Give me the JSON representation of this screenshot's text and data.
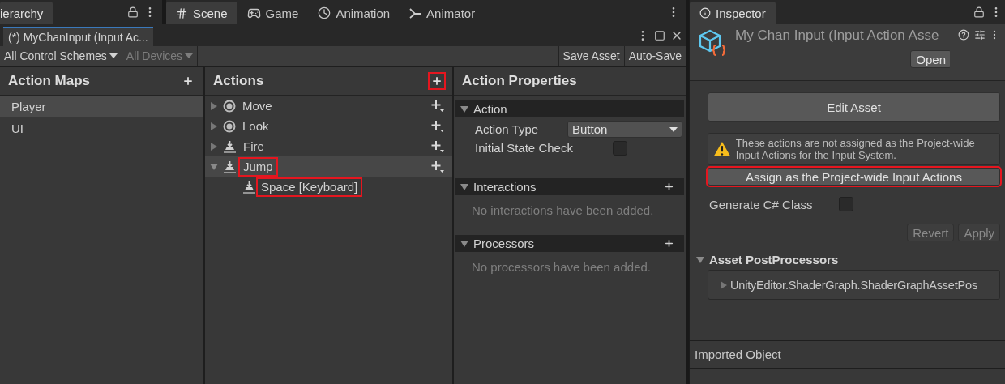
{
  "top_tabs": {
    "hierarchy": {
      "label": "ierarchy",
      "selected": true
    },
    "center": [
      {
        "label": "Scene",
        "kind": "scene",
        "selected": true
      },
      {
        "label": "Game",
        "kind": "game",
        "selected": false
      },
      {
        "label": "Animation",
        "kind": "animation",
        "selected": false
      },
      {
        "label": "Animator",
        "kind": "animator",
        "selected": false
      }
    ]
  },
  "editor": {
    "tab_title": "(*) MyChanInput (Input Ac...",
    "toolbar": {
      "control_scheme": "All Control Schemes",
      "devices": {
        "label": "All Devices",
        "disabled": true
      },
      "buttons": [
        "Save Asset",
        "Auto-Save"
      ]
    },
    "action_maps": {
      "title": "Action Maps",
      "items": [
        {
          "label": "Player",
          "selected": true
        },
        {
          "label": "UI",
          "selected": false
        }
      ]
    },
    "actions": {
      "title": "Actions",
      "add_highlighted": true,
      "items": [
        {
          "label": "Move",
          "kind": "value",
          "expanded": false,
          "selected": false,
          "highlighted": false
        },
        {
          "label": "Look",
          "kind": "value",
          "expanded": false,
          "selected": false,
          "highlighted": false
        },
        {
          "label": "Fire",
          "kind": "button",
          "expanded": false,
          "selected": false,
          "highlighted": false
        },
        {
          "label": "Jump",
          "kind": "button",
          "expanded": true,
          "selected": true,
          "highlighted": true,
          "children": [
            {
              "label": "Space [Keyboard]",
              "highlighted": true
            }
          ]
        }
      ]
    },
    "properties": {
      "title": "Action Properties",
      "sections": [
        {
          "title": "Action",
          "kind": "fields",
          "fields": [
            {
              "kind": "dropdown",
              "label": "Action Type",
              "value": "Button"
            },
            {
              "kind": "checkbox",
              "label": "Initial State Check",
              "checked": false
            }
          ]
        },
        {
          "title": "Interactions",
          "kind": "empty",
          "message": "No interactions have been added."
        },
        {
          "title": "Processors",
          "kind": "empty",
          "message": "No processors have been added."
        }
      ]
    }
  },
  "inspector": {
    "title": "Inspector",
    "asset_name": "My Chan Input (Input Action Asse",
    "open_button": "Open",
    "edit_button": "Edit Asset",
    "warning": "These actions are not assigned as the Project-wide Input Actions for the Input System.",
    "assign_button": {
      "label": "Assign as the Project-wide Input Actions",
      "highlighted": true
    },
    "generate_class": {
      "label": "Generate C# Class",
      "checked": false
    },
    "revert_button": {
      "label": "Revert",
      "disabled": true
    },
    "apply_button": {
      "label": "Apply",
      "disabled": true
    },
    "postprocessors": {
      "title": "Asset PostProcessors",
      "expanded": true,
      "items": [
        {
          "label": "UnityEditor.ShaderGraph.ShaderGraphAssetPos",
          "expanded": false
        }
      ]
    },
    "footer": "Imported Object"
  }
}
